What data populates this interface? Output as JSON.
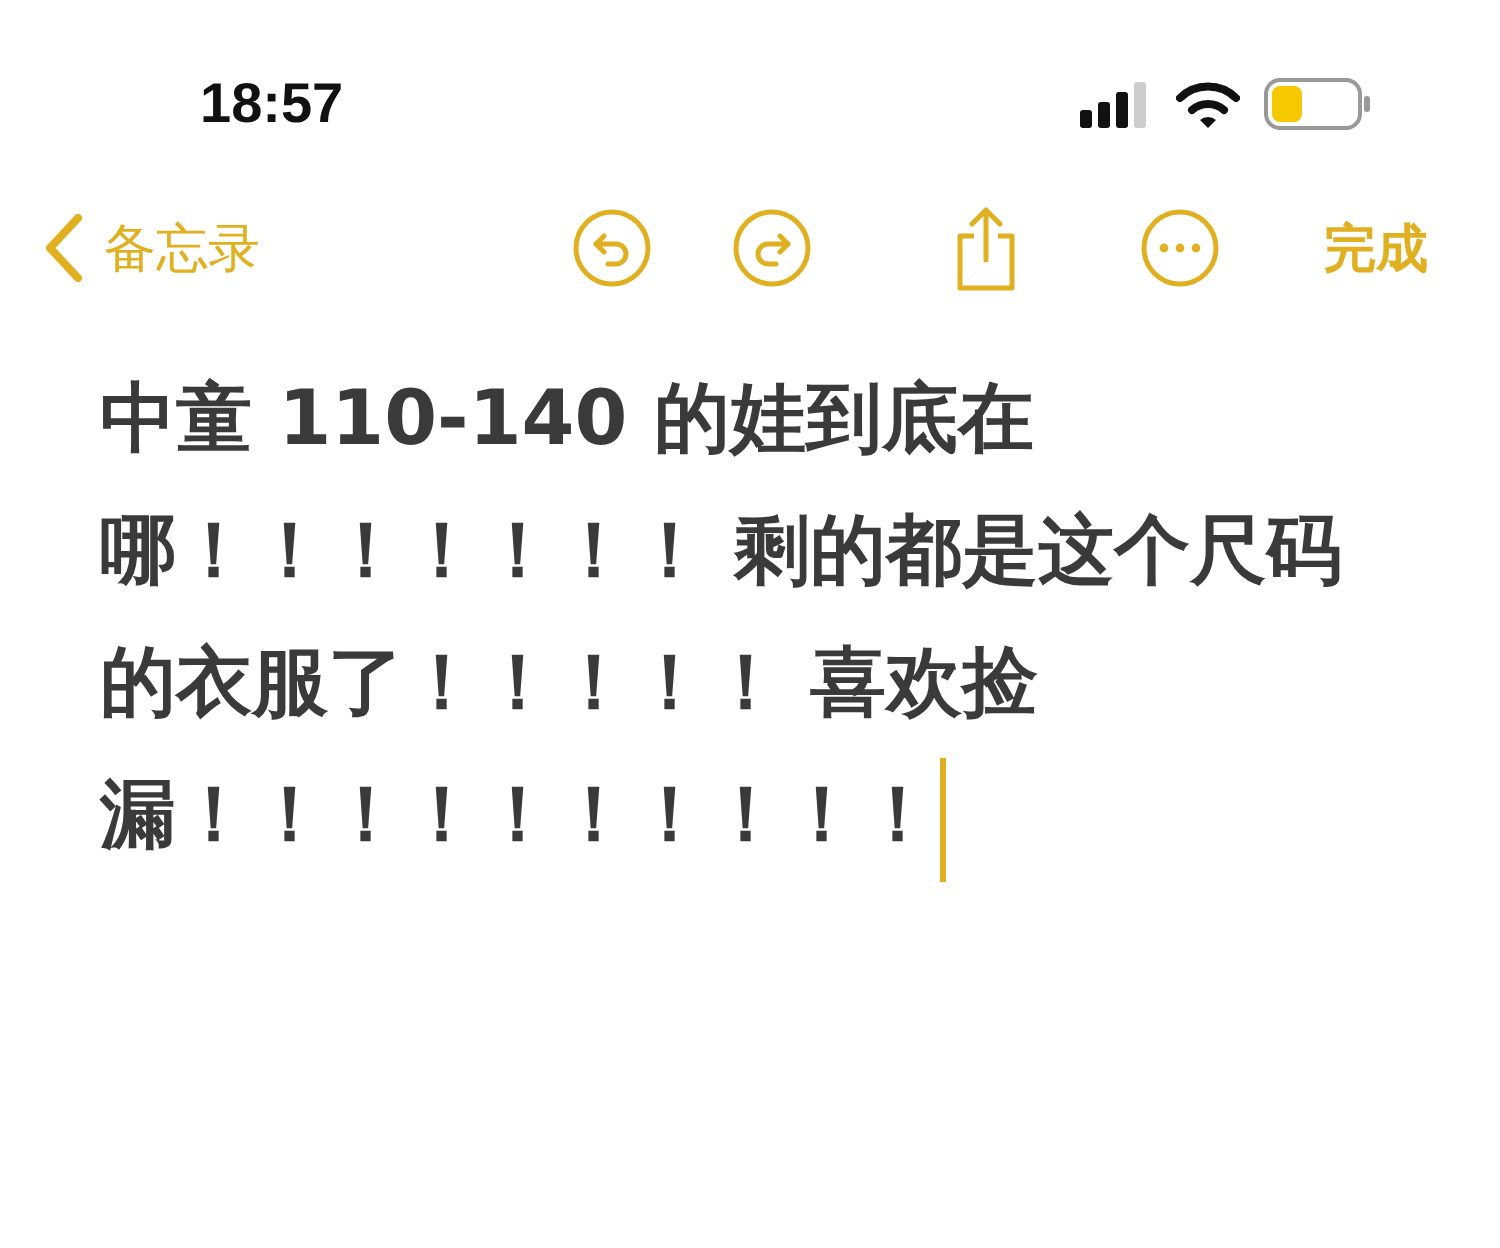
{
  "status_bar": {
    "time": "18:57"
  },
  "toolbar": {
    "back_label": "备忘录",
    "done_label": "完成"
  },
  "note": {
    "text": "中童 110-140 的娃到底在哪！！！！！！！ 剩的都是这个尺码的衣服了！！！！！ 喜欢捡漏！！！！！！！！！！"
  }
}
